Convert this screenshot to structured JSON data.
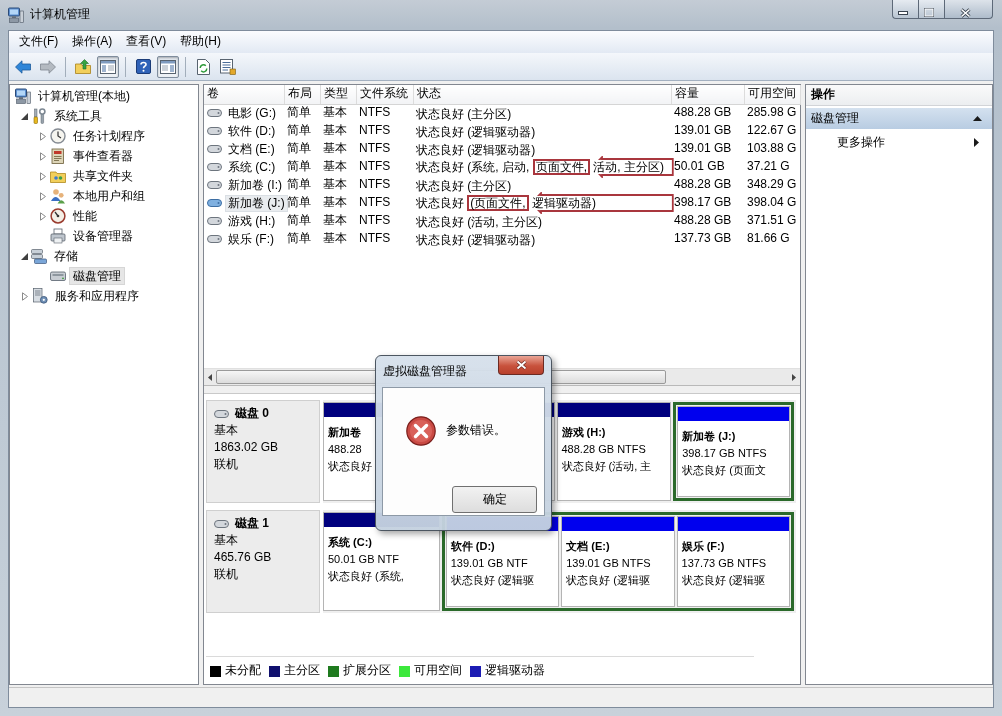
{
  "window": {
    "title": "计算机管理"
  },
  "menu": [
    {
      "label": "文件(F)"
    },
    {
      "label": "操作(A)"
    },
    {
      "label": "查看(V)"
    },
    {
      "label": "帮助(H)"
    }
  ],
  "toolbar": [
    {
      "kind": "back",
      "disabled": false,
      "pressed": false
    },
    {
      "kind": "forward",
      "disabled": true,
      "pressed": false
    },
    {
      "kind": "separator"
    },
    {
      "kind": "up",
      "disabled": false,
      "pressed": false
    },
    {
      "kind": "tree",
      "disabled": false,
      "pressed": true
    },
    {
      "kind": "separator"
    },
    {
      "kind": "help",
      "disabled": false,
      "pressed": false
    },
    {
      "kind": "pane",
      "disabled": false,
      "pressed": true
    },
    {
      "kind": "separator"
    },
    {
      "kind": "refresh",
      "disabled": false,
      "pressed": false
    },
    {
      "kind": "export",
      "disabled": false,
      "pressed": false
    }
  ],
  "tree": [
    {
      "label": "计算机管理(本地)",
      "kind": "computer",
      "selected": false,
      "children": [
        {
          "label": "系统工具",
          "kind": "tools",
          "expanded": true,
          "selected": false,
          "children": [
            {
              "label": "任务计划程序",
              "kind": "scheduler",
              "expanded": false,
              "selected": false
            },
            {
              "label": "事件查看器",
              "kind": "events",
              "expanded": false,
              "selected": false
            },
            {
              "label": "共享文件夹",
              "kind": "shares",
              "expanded": false,
              "selected": false
            },
            {
              "label": "本地用户和组",
              "kind": "users",
              "expanded": false,
              "selected": false
            },
            {
              "label": "性能",
              "kind": "performance",
              "expanded": false,
              "selected": false
            },
            {
              "label": "设备管理器",
              "kind": "devices",
              "selected": false
            }
          ]
        },
        {
          "label": "存储",
          "kind": "storage",
          "expanded": true,
          "selected": false,
          "children": [
            {
              "label": "磁盘管理",
              "kind": "disks",
              "selected": true
            }
          ]
        },
        {
          "label": "服务和应用程序",
          "kind": "services",
          "expanded": false,
          "selected": false
        }
      ]
    }
  ],
  "volumes": {
    "columns": [
      "卷",
      "布局",
      "类型",
      "文件系统",
      "状态",
      "容量",
      "可用空间"
    ],
    "rows": [
      {
        "volume": "电影 (G:)",
        "layout": "简单",
        "type": "基本",
        "filesystem": "NTFS",
        "status": [
          {
            "text": "状态良好 (主分区)",
            "boxed": false
          }
        ],
        "capacity": "488.28 GB",
        "free": "285.98 G",
        "selected": false,
        "arrow": false
      },
      {
        "volume": "软件 (D:)",
        "layout": "简单",
        "type": "基本",
        "filesystem": "NTFS",
        "status": [
          {
            "text": "状态良好 (逻辑驱动器)",
            "boxed": false
          }
        ],
        "capacity": "139.01 GB",
        "free": "122.67 G",
        "selected": false,
        "arrow": false
      },
      {
        "volume": "文档 (E:)",
        "layout": "简单",
        "type": "基本",
        "filesystem": "NTFS",
        "status": [
          {
            "text": "状态良好 (逻辑驱动器)",
            "boxed": false
          }
        ],
        "capacity": "139.01 GB",
        "free": "103.88 G",
        "selected": false,
        "arrow": false
      },
      {
        "volume": "系统 (C:)",
        "layout": "简单",
        "type": "基本",
        "filesystem": "NTFS",
        "status": [
          {
            "text": "状态良好 (系统, 启动, ",
            "boxed": false
          },
          {
            "text": "页面文件,",
            "boxed": true
          },
          {
            "text": " 活动, 主分区)",
            "boxed": false
          }
        ],
        "capacity": "50.01 GB",
        "free": "37.21 G",
        "selected": false,
        "arrow": true
      },
      {
        "volume": "新加卷 (I:)",
        "layout": "简单",
        "type": "基本",
        "filesystem": "NTFS",
        "status": [
          {
            "text": "状态良好 (主分区)",
            "boxed": false
          }
        ],
        "capacity": "488.28 GB",
        "free": "348.29 G",
        "selected": false,
        "arrow": false
      },
      {
        "volume": "新加卷 (J:)",
        "layout": "简单",
        "type": "基本",
        "filesystem": "NTFS",
        "status": [
          {
            "text": "状态良好 ",
            "boxed": false
          },
          {
            "text": "(页面文件,",
            "boxed": true
          },
          {
            "text": " 逻辑驱动器)",
            "boxed": false
          }
        ],
        "capacity": "398.17 GB",
        "free": "398.04 G",
        "selected": true,
        "arrow": true
      },
      {
        "volume": "游戏 (H:)",
        "layout": "简单",
        "type": "基本",
        "filesystem": "NTFS",
        "status": [
          {
            "text": "状态良好 (活动, 主分区)",
            "boxed": false
          }
        ],
        "capacity": "488.28 GB",
        "free": "371.51 G",
        "selected": false,
        "arrow": false
      },
      {
        "volume": "娱乐 (F:)",
        "layout": "简单",
        "type": "基本",
        "filesystem": "NTFS",
        "status": [
          {
            "text": "状态良好 (逻辑驱动器)",
            "boxed": false
          }
        ],
        "capacity": "137.73 GB",
        "free": "81.66 G",
        "selected": false,
        "arrow": false
      }
    ]
  },
  "actions": {
    "title": "操作",
    "groups": [
      {
        "label": "磁盘管理",
        "expanded": true,
        "items": [
          {
            "label": "更多操作",
            "submenu": true
          }
        ]
      }
    ]
  },
  "disks": [
    {
      "name": "磁盘 0",
      "type": "基本",
      "size": "1863.02 GB",
      "state": "联机",
      "partitions": [
        {
          "kind": "primary",
          "name": "新加卷",
          "detail": "488.28",
          "status": "状态良好"
        },
        {
          "kind": "primary"
        },
        {
          "kind": "primary",
          "name": "游戏 (H:)",
          "detail": "488.28 GB NTFS",
          "status": "状态良好 (活动, 主"
        },
        {
          "kind": "extended",
          "children": [
            {
              "kind": "logical",
              "name": "新加卷 (J:)",
              "detail": "398.17 GB NTFS",
              "status": "状态良好 (页面文"
            }
          ]
        }
      ]
    },
    {
      "name": "磁盘 1",
      "type": "基本",
      "size": "465.76 GB",
      "state": "联机",
      "partitions": [
        {
          "kind": "primary",
          "name": "系统 (C:)",
          "detail": "50.01 GB NTF",
          "status": "状态良好 (系统,"
        },
        {
          "kind": "extended",
          "children": [
            {
              "kind": "logical",
              "name": "软件 (D:)",
              "detail": "139.01 GB NTF",
              "status": "状态良好 (逻辑驱"
            },
            {
              "kind": "logical",
              "name": "文档 (E:)",
              "detail": "139.01 GB NTFS",
              "status": "状态良好 (逻辑驱"
            },
            {
              "kind": "logical",
              "name": "娱乐 (F:)",
              "detail": "137.73 GB NTFS",
              "status": "状态良好 (逻辑驱"
            }
          ]
        }
      ]
    }
  ],
  "legend": [
    {
      "label": "未分配",
      "color": "#000000"
    },
    {
      "label": "主分区",
      "color": "#10106e"
    },
    {
      "label": "扩展分区",
      "color": "#1e7a1e"
    },
    {
      "label": "可用空间",
      "color": "#3ce83c"
    },
    {
      "label": "逻辑驱动器",
      "color": "#1c1cb4"
    }
  ],
  "dialog": {
    "title": "虚拟磁盘管理器",
    "kind": "error",
    "message": "参数错误。",
    "buttons": [
      "确定"
    ]
  }
}
